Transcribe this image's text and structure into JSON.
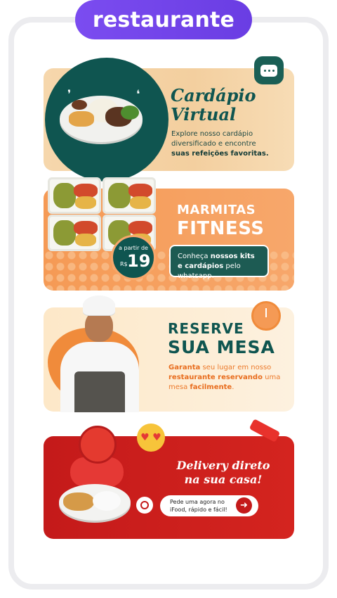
{
  "header": {
    "pill_label": "restaurante"
  },
  "cards": {
    "menu": {
      "title_line1": "Cardápio",
      "title_line2": "Virtual",
      "text_line1": "Explore nosso cardápio",
      "text_line2": "diversificado e encontre",
      "text_bold": "suas refeições favoritas.",
      "icon": "chat-icon"
    },
    "fitness": {
      "title_line1": "MARMITAS",
      "title_line2": "FITNESS",
      "price_prefix": "a partir de",
      "price_currency": "R$",
      "price_value": "19",
      "cta_pre": "Conheça ",
      "cta_bold": "nossos kits e cardápios",
      "cta_post": " pelo whatsapp."
    },
    "reserve": {
      "title_line1": "RESERVE",
      "title_line2": "SUA MESA",
      "text_bold1": "Garanta",
      "text_mid1": " seu lugar em nosso ",
      "text_bold2": "restaurante reservando",
      "text_mid2": " uma mesa ",
      "text_bold3": "facilmente",
      "text_end": ".",
      "icon": "alarm-clock-icon"
    },
    "delivery": {
      "title_line1": "Delivery direto",
      "title_line2": "na sua casa!",
      "pill_line1": "Pede uma agora no",
      "pill_line2": "iFood, rápido e fácil!",
      "icon": "whatsapp-icon",
      "arrow_icon": "arrow-right-icon"
    }
  },
  "colors": {
    "purple": "#7b4cf0",
    "teal": "#0f5550",
    "orange": "#f59a55",
    "red": "#c41a1a",
    "cream": "#fde8c8"
  }
}
